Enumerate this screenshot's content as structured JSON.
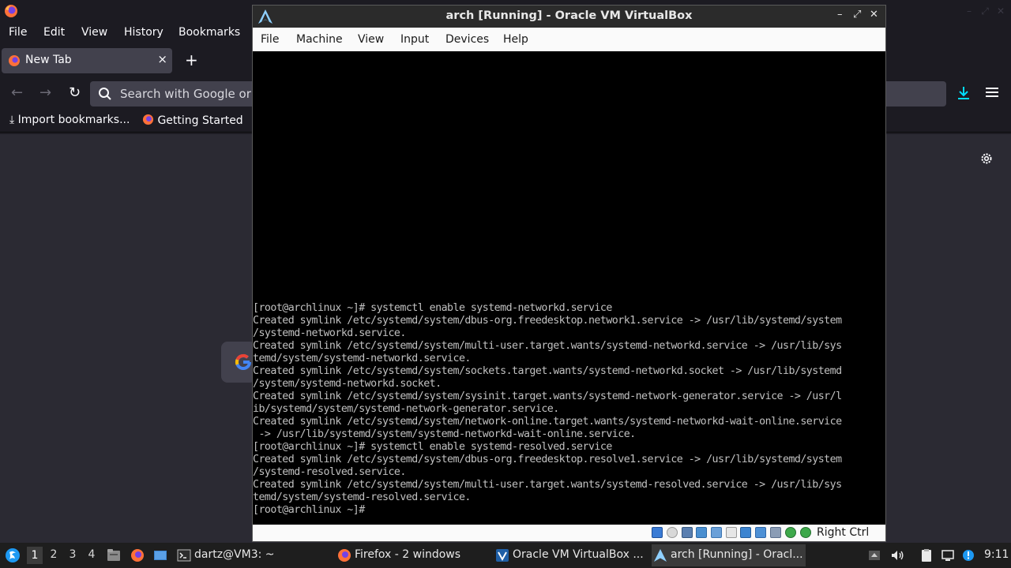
{
  "firefox": {
    "menu": [
      "File",
      "Edit",
      "View",
      "History",
      "Bookmarks"
    ],
    "tab": {
      "title": "New Tab",
      "close": "×"
    },
    "newtab": "+",
    "nav": {
      "back": "←",
      "forward": "→",
      "reload": "↻"
    },
    "url_placeholder": "Search with Google or e",
    "bookmarks": [
      "Import bookmarks...",
      "Getting Started"
    ]
  },
  "vbox": {
    "title": "arch [Running] - Oracle VM VirtualBox",
    "controls": {
      "minimize": "–",
      "maximize": "⤢",
      "close": "✕"
    },
    "menu": [
      "File",
      "Machine",
      "View",
      "Input",
      "Devices",
      "Help"
    ],
    "terminal_lines": [
      "[root@archlinux ~]# systemctl enable systemd-networkd.service",
      "Created symlink /etc/systemd/system/dbus-org.freedesktop.network1.service -> /usr/lib/systemd/system",
      "/systemd-networkd.service.",
      "Created symlink /etc/systemd/system/multi-user.target.wants/systemd-networkd.service -> /usr/lib/sys",
      "temd/system/systemd-networkd.service.",
      "Created symlink /etc/systemd/system/sockets.target.wants/systemd-networkd.socket -> /usr/lib/systemd",
      "/system/systemd-networkd.socket.",
      "Created symlink /etc/systemd/system/sysinit.target.wants/systemd-network-generator.service -> /usr/l",
      "ib/systemd/system/systemd-network-generator.service.",
      "Created symlink /etc/systemd/system/network-online.target.wants/systemd-networkd-wait-online.service",
      " -> /usr/lib/systemd/system/systemd-networkd-wait-online.service.",
      "[root@archlinux ~]# systemctl enable systemd-resolved.service",
      "Created symlink /etc/systemd/system/dbus-org.freedesktop.resolve1.service -> /usr/lib/systemd/system",
      "/systemd-resolved.service.",
      "Created symlink /etc/systemd/system/multi-user.target.wants/systemd-resolved.service -> /usr/lib/sys",
      "temd/system/systemd-resolved.service.",
      "[root@archlinux ~]#"
    ],
    "host_key": "Right Ctrl"
  },
  "taskbar": {
    "workspaces": [
      "1",
      "2",
      "3",
      "4"
    ],
    "tasks": [
      {
        "label": "dartz@VM3: ~"
      },
      {
        "label": "Firefox - 2 windows"
      },
      {
        "label": "Oracle VM VirtualBox ..."
      },
      {
        "label": "arch [Running] - Oracl..."
      }
    ],
    "clock": "9:11"
  }
}
